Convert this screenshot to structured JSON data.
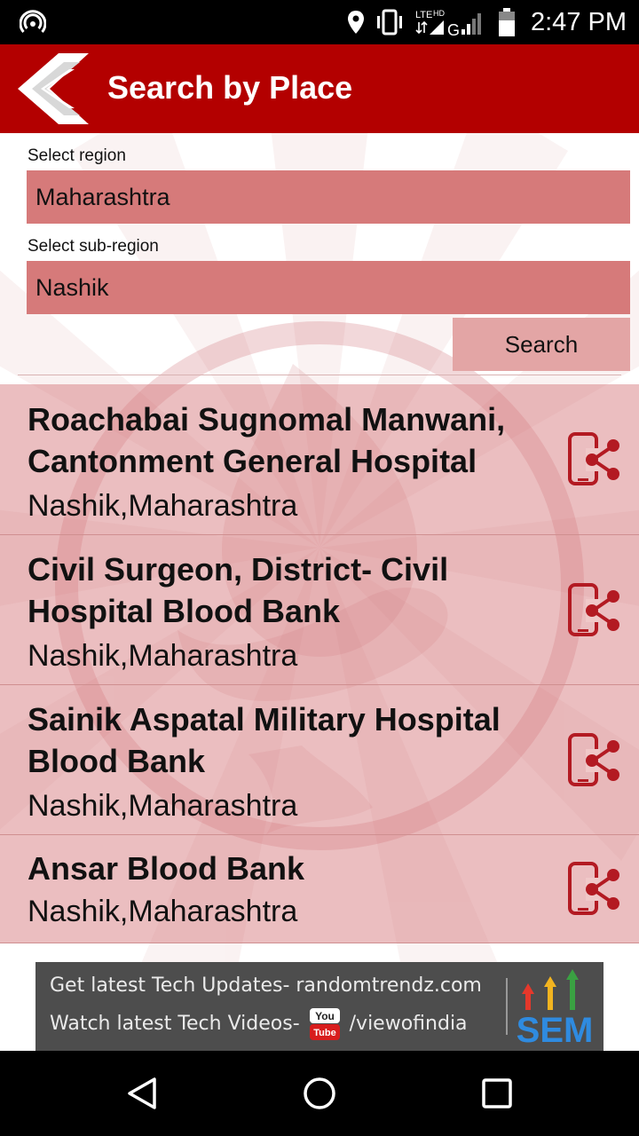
{
  "status_bar": {
    "time": "2:47 PM",
    "network_label_lte": "LTE",
    "network_label_hd": "HD",
    "network_label_g": "G",
    "icons": [
      "hotspot-icon",
      "location-icon",
      "vibrate-icon",
      "signal-icon",
      "battery-icon"
    ]
  },
  "app_bar": {
    "title": "Search by Place",
    "back_icon": "back-arrow-icon",
    "color": "#b30000"
  },
  "form": {
    "region_label": "Select region",
    "region_value": "Maharashtra",
    "subregion_label": "Select sub-region",
    "subregion_value": "Nashik",
    "search_label": "Search",
    "field_color": "#d67a7a"
  },
  "results": [
    {
      "name": "Roachabai Sugnomal Manwani, Cantonment General Hospital",
      "place": "Nashik,Maharashtra"
    },
    {
      "name": "Civil Surgeon, District- Civil Hospital Blood Bank",
      "place": "Nashik,Maharashtra"
    },
    {
      "name": "Sainik Aspatal Military Hospital Blood Bank",
      "place": "Nashik,Maharashtra"
    },
    {
      "name": "Ansar Blood Bank",
      "place": "Nashik,Maharashtra"
    }
  ],
  "ad": {
    "line1": "Get latest Tech Updates- randomtrendz.com",
    "line2_prefix": "Watch latest Tech Videos-",
    "line2_suffix": "/viewofindia",
    "yt_top": "You",
    "yt_bottom": "Tube",
    "brand": "SEM"
  },
  "nav_bar": {
    "icons": [
      "back-triangle-icon",
      "home-circle-icon",
      "recents-square-icon"
    ]
  }
}
